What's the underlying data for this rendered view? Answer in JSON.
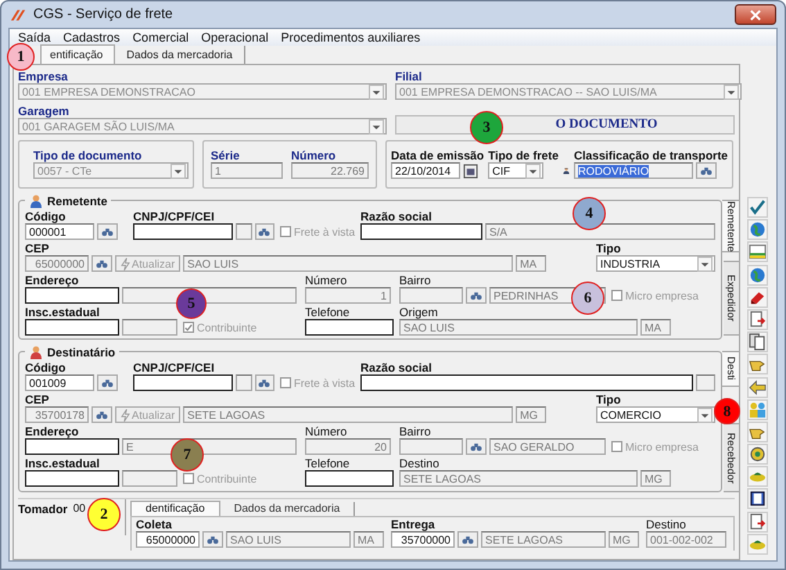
{
  "window": {
    "title": "CGS - Serviço de frete"
  },
  "menu": [
    "Saída",
    "Cadastros",
    "Comercial",
    "Operacional",
    "Procedimentos auxiliares"
  ],
  "tabs": [
    {
      "label": "entificação",
      "selected": true
    },
    {
      "label": "Dados da mercadoria",
      "selected": false
    }
  ],
  "empresa": {
    "label": "Empresa",
    "value": "001 EMPRESA DEMONSTRACAO"
  },
  "filial": {
    "label": "Filial",
    "value": "001 EMPRESA DEMONSTRACAO -- SAO LUIS/MA"
  },
  "garagem": {
    "label": "Garagem",
    "value": "001 GARAGEM SÃO LUIS/MA"
  },
  "document_status": "O DOCUMENTO",
  "tipo_documento": {
    "label": "Tipo de documento",
    "value": "0057 - CTe"
  },
  "serie": {
    "label": "Série",
    "value": "1"
  },
  "numero": {
    "label": "Número",
    "value": "22.769"
  },
  "data_emissao": {
    "label": "Data de emissão",
    "value": "22/10/2014"
  },
  "tipo_frete": {
    "label": "Tipo de frete",
    "value": "CIF"
  },
  "classificacao": {
    "label": "Classificação de transporte",
    "value": "RODOVIÁRIO",
    "selected": true
  },
  "parties": [
    {
      "title": "Remetente",
      "codigo_label": "Código",
      "codigo": "000001",
      "cnpj_label": "CNPJ/CPF/CEI",
      "frete_vista": {
        "label": "Frete à vista",
        "checked": false
      },
      "razao_label": "Razão social",
      "razao": "S/A",
      "cep_label": "CEP",
      "cep": "65000000",
      "atualizar": "Atualizar",
      "cidade": "SAO LUIS",
      "uf": "MA",
      "tipo_label": "Tipo",
      "tipo": "INDUSTRIA",
      "endereco_label": "Endereço",
      "numero_label": "Número",
      "numero": "1",
      "bairro_label": "Bairro",
      "bairro": "PEDRINHAS",
      "micro": {
        "label": "Micro empresa",
        "checked": false
      },
      "ie_label": "Insc.estadual",
      "contribuinte": {
        "label": "Contribuinte",
        "checked": true
      },
      "telefone_label": "Telefone",
      "local_label": "Origem",
      "local": "SAO LUIS",
      "local_uf": "MA",
      "side_tabs": [
        {
          "label": "Remetente",
          "selected": true
        },
        {
          "label": "Expedidor",
          "selected": false
        }
      ]
    },
    {
      "title": "Destinatário",
      "codigo_label": "Código",
      "codigo": "001009",
      "cnpj_label": "CNPJ/CPF/CEI",
      "frete_vista": {
        "label": "Frete à vista",
        "checked": false
      },
      "razao_label": "Razão social",
      "cep_label": "CEP",
      "cep": "35700178",
      "atualizar": "Atualizar",
      "cidade": "SETE LAGOAS",
      "uf": "MG",
      "tipo_label": "Tipo",
      "tipo": "COMERCIO",
      "endereco_label": "Endereço",
      "endereco": "E",
      "numero_label": "Número",
      "numero": "20",
      "bairro_label": "Bairro",
      "bairro": "SAO GERALDO",
      "micro": {
        "label": "Micro empresa",
        "checked": false
      },
      "ie_label": "Insc.estadual",
      "contribuinte": {
        "label": "Contribuinte",
        "checked": false
      },
      "telefone_label": "Telefone",
      "local_label": "Destino",
      "local": "SETE LAGOAS",
      "local_uf": "MG",
      "side_tabs": [
        {
          "label": "Desti",
          "selected": true
        },
        {
          "label": "Recebedor",
          "selected": false
        }
      ]
    }
  ],
  "tomador": {
    "label": "Tomador",
    "value": "00"
  },
  "bottom_tabs": [
    {
      "label": "dentificação",
      "selected": true
    },
    {
      "label": "Dados da mercadoria",
      "selected": false
    }
  ],
  "coleta": {
    "label": "Coleta",
    "cep": "65000000",
    "cidade": "SAO LUIS",
    "uf": "MA"
  },
  "entrega": {
    "label": "Entrega",
    "cep": "35700000",
    "cidade": "SETE LAGOAS",
    "uf": "MG"
  },
  "destino": {
    "label": "Destino",
    "value": "001-002-002"
  },
  "callouts": [
    {
      "number": "1",
      "color": "#f7b9c8"
    },
    {
      "number": "2",
      "color": "#ffff33"
    },
    {
      "number": "3",
      "color": "#1ea63c"
    },
    {
      "number": "4",
      "color": "#8fa9cf"
    },
    {
      "number": "5",
      "color": "#6a3a9a"
    },
    {
      "number": "6",
      "color": "#c8c0dc"
    },
    {
      "number": "7",
      "color": "#8a7f50"
    },
    {
      "number": "8",
      "color": "#ff0000"
    }
  ]
}
